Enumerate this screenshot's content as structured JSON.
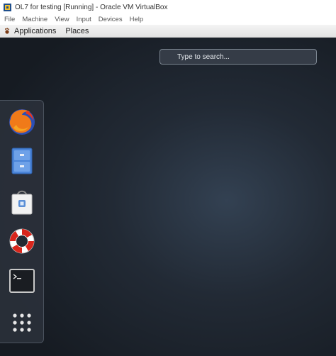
{
  "window": {
    "title": "OL7 for testing [Running] - Oracle VM VirtualBox",
    "icon": "virtualbox-icon"
  },
  "host_menu": [
    "File",
    "Machine",
    "View",
    "Input",
    "Devices",
    "Help"
  ],
  "guest_topbar": {
    "applications_label": "Applications",
    "places_label": "Places"
  },
  "search": {
    "placeholder": "Type to search..."
  },
  "dash": {
    "items": [
      {
        "name": "firefox",
        "icon": "firefox-icon"
      },
      {
        "name": "files",
        "icon": "file-cabinet-icon"
      },
      {
        "name": "software",
        "icon": "shopping-bag-icon"
      },
      {
        "name": "help",
        "icon": "lifebuoy-icon"
      },
      {
        "name": "terminal",
        "icon": "terminal-icon"
      },
      {
        "name": "show-applications",
        "icon": "app-grid-icon"
      }
    ]
  }
}
